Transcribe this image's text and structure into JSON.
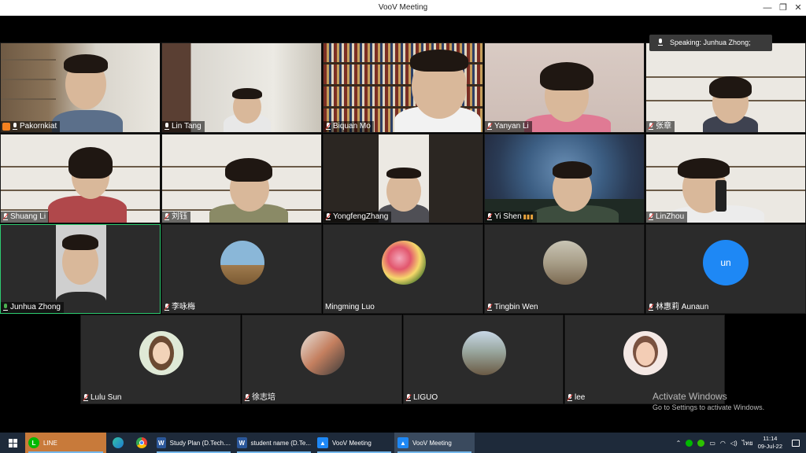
{
  "window": {
    "title": "VooV Meeting"
  },
  "window_controls": {
    "minimize": "—",
    "maximize": "❐",
    "close": "✕"
  },
  "speaking": {
    "label": "Speaking: Junhua Zhong;"
  },
  "participants": [
    {
      "name": "Pakornkiat",
      "video": true,
      "host_icon": true
    },
    {
      "name": "Lin Tang",
      "video": true
    },
    {
      "name": "Biquan Mo",
      "video": true
    },
    {
      "name": "Yanyan Li",
      "video": true
    },
    {
      "name": "张章",
      "video": true
    },
    {
      "name": "Shuang Li",
      "video": true
    },
    {
      "name": "刘钰",
      "video": true
    },
    {
      "name": "YongfengZhang",
      "video": true
    },
    {
      "name": "Yi Shen",
      "video": true
    },
    {
      "name": "LinZhou",
      "video": true
    },
    {
      "name": "Junhua Zhong",
      "video": true,
      "speaking": true
    },
    {
      "name": "李咏梅",
      "video": false
    },
    {
      "name": "Mingming Luo",
      "video": false
    },
    {
      "name": "Tingbin Wen",
      "video": false
    },
    {
      "name": "林惠莉 Aunaun",
      "video": false,
      "avatar_text": "un"
    },
    {
      "name": "Lulu Sun",
      "video": false
    },
    {
      "name": "徐志培",
      "video": false
    },
    {
      "name": "LIGUO",
      "video": false
    },
    {
      "name": "lee",
      "video": false
    }
  ],
  "watermark": {
    "line1": "Activate Windows",
    "line2": "Go to Settings to activate Windows."
  },
  "taskbar": {
    "items": [
      {
        "label": "LINE",
        "icon": "line-icon",
        "color": "#00b900"
      },
      {
        "label": "Study Plan (D.Tech....",
        "icon": "word-icon",
        "color": "#2b579a"
      },
      {
        "label": "student name (D.Te...",
        "icon": "word-icon",
        "color": "#2b579a"
      },
      {
        "label": "VooV Meeting",
        "icon": "voov-icon",
        "color": "#1e88f5"
      },
      {
        "label": "VooV Meeting",
        "icon": "voov-icon",
        "color": "#1e88f5"
      }
    ],
    "time": "11:14",
    "date": "09-Jul-22",
    "lang": "ไทย"
  },
  "colors": {
    "speaking_border": "#2ecc71",
    "avatar_blue": "#1e88f5",
    "taskbar": "#1e2a3a"
  }
}
